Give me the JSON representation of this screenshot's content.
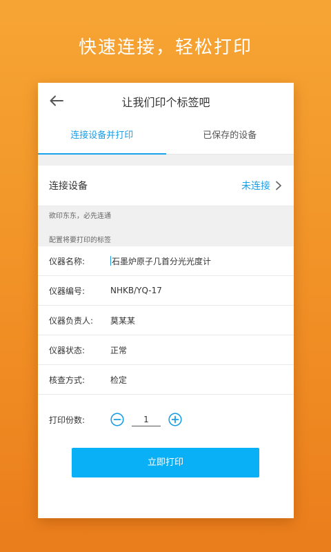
{
  "headline": "快速连接，轻松打印",
  "header": {
    "title": "让我们印个标签吧",
    "back_icon": "arrow-left-icon"
  },
  "tabs": [
    {
      "label": "连接设备并打印",
      "active": true
    },
    {
      "label": "已保存的设备",
      "active": false
    }
  ],
  "connect": {
    "label": "连接设备",
    "status": "未连接",
    "status_color": "#1a9ee6"
  },
  "notes": {
    "hint": "欲印东东，必先连通",
    "section_title": "配置将要打印的标签"
  },
  "fields": [
    {
      "label": "仪器名称:",
      "value": "石墨炉原子几首分光光度计"
    },
    {
      "label": "仪器编号:",
      "value": "NHKB/YQ-17"
    },
    {
      "label": "仪器负责人:",
      "value": "莫某某"
    },
    {
      "label": "仪器状态:",
      "value": "正常"
    },
    {
      "label": "核查方式:",
      "value": "检定"
    }
  ],
  "copies": {
    "label": "打印份数:",
    "value": "1"
  },
  "print_button": "立即打印",
  "colors": {
    "accent": "#1a9ee6",
    "button": "#0ab0f5",
    "background_orange": "#f39a2c"
  }
}
